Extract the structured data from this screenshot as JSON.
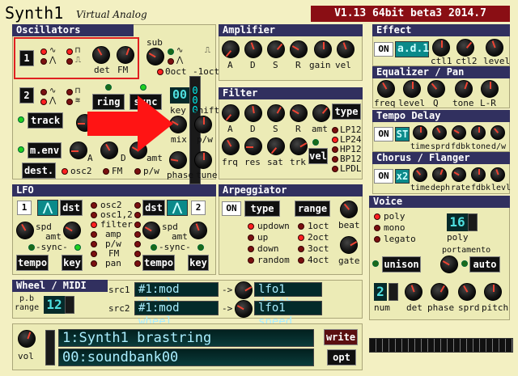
{
  "header": {
    "title": "Synth1",
    "subtitle": "Virtual Analog",
    "version": "V1.13 64bit beta3 2014.7"
  },
  "oscillators": {
    "title": "Oscillators",
    "osc1_num": "1",
    "osc2_num": "2",
    "det": "det",
    "fm": "FM",
    "sub": "sub",
    "oct0": "0oct",
    "oct1": "-1oct",
    "ring": "ring",
    "sync": "sync",
    "track": "track",
    "key": "key",
    "shift": "shift",
    "display": "00",
    "mix": "mix",
    "pw": "p/w",
    "phase": "phase",
    "tune": "tune",
    "menv": "m.env",
    "dest": "dest.",
    "a": "A",
    "d": "D",
    "amt": "amt",
    "osc2": "osc2",
    "fm2": "FM",
    "pw2": "p/w"
  },
  "amplifier": {
    "title": "Amplifier",
    "labels": [
      "A",
      "D",
      "S",
      "R",
      "gain",
      "vel"
    ]
  },
  "filter": {
    "title": "Filter",
    "row1": [
      "A",
      "D",
      "S",
      "R",
      "amt"
    ],
    "row2": [
      "frq",
      "res",
      "sat",
      "trk"
    ],
    "type": "type",
    "vel": "vel",
    "types": [
      "LP12",
      "LP24",
      "HP12",
      "BP12",
      "LPDL"
    ]
  },
  "effect": {
    "title": "Effect",
    "on": "ON",
    "name": "a.d.1",
    "labels": [
      "ctl1",
      "ctl2",
      "level"
    ]
  },
  "eq": {
    "title": "Equalizer / Pan",
    "labels": [
      "freq",
      "level",
      "Q",
      "tone",
      "L-R"
    ]
  },
  "tempo_delay": {
    "title": "Tempo Delay",
    "on": "ON",
    "st": "ST",
    "labels": [
      "time",
      "sprd",
      "fdbk",
      "tone",
      "d/w"
    ]
  },
  "chorus": {
    "title": "Chorus / Flanger",
    "on": "ON",
    "x2": "x2",
    "labels": [
      "time",
      "deph",
      "rate",
      "fdbk",
      "levl"
    ]
  },
  "lfo": {
    "title": "LFO",
    "lfo1": "1",
    "lfo2": "2",
    "dst": "dst",
    "spd": "spd",
    "amt": "amt",
    "sync": "-sync-",
    "tempo": "tempo",
    "key": "key",
    "dests": [
      "osc2",
      "osc1,2",
      "filter",
      "amp",
      "p/w",
      "FM",
      "pan"
    ]
  },
  "arpeggiator": {
    "title": "Arpeggiator",
    "on": "ON",
    "type": "type",
    "range": "range",
    "modes": [
      "updown",
      "up",
      "down",
      "random"
    ],
    "ranges": [
      "1oct",
      "2oct",
      "3oct",
      "4oct"
    ],
    "beat": "beat",
    "gate": "gate"
  },
  "voice": {
    "title": "Voice",
    "modes": [
      "poly",
      "mono",
      "legato"
    ],
    "poly_count": "16",
    "poly": "poly",
    "portamento": "portamento",
    "unison": "unison",
    "auto": "auto",
    "num_value": "2",
    "labels": [
      "num",
      "det",
      "phase",
      "sprd",
      "pitch"
    ]
  },
  "wheel": {
    "title": "Wheel / MIDI",
    "pb": "p.b",
    "range": "range",
    "range_value": "12",
    "src1": "src1",
    "src2": "src2",
    "src1_value": "#1:mod wheel",
    "src2_value": "#1:mod wheel",
    "arrow": "->",
    "dest1": "lfo1 depth",
    "dest2": "lfo1 speed"
  },
  "patch": {
    "vol": "vol",
    "name": "1:Synth1 brastring",
    "bank": "00:soundbank00",
    "write": "write",
    "opt": "opt"
  }
}
